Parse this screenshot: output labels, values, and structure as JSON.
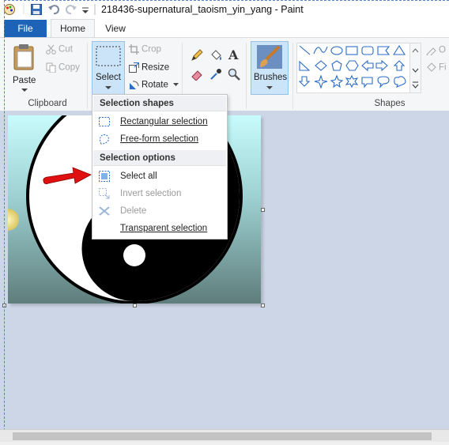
{
  "window": {
    "title": "218436-supernatural_taoism_yin_yang - Paint"
  },
  "tabs": [
    {
      "label": "File"
    },
    {
      "label": "Home"
    },
    {
      "label": "View"
    }
  ],
  "clipboard": {
    "paste_label": "Paste",
    "cut_label": "Cut",
    "copy_label": "Copy",
    "group_label": "Clipboard"
  },
  "image_group": {
    "select_label": "Select",
    "crop_label": "Crop",
    "resize_label": "Resize",
    "rotate_label": "Rotate"
  },
  "brushes": {
    "label": "Brushes"
  },
  "shapes": {
    "group_label": "Shapes",
    "outline_partial": "O",
    "fill_partial": "Fi"
  },
  "select_menu": {
    "header_shapes": "Selection shapes",
    "rect": "Rectangular selection",
    "freeform": "Free-form selection",
    "header_options": "Selection options",
    "select_all": "Select all",
    "invert": "Invert selection",
    "delete": "Delete",
    "transparent": "Transparent selection"
  },
  "colors": {
    "accent": "#1d64b8",
    "canvas_bg": "#cdd6e6",
    "annotation_arrow": "#e01010"
  }
}
